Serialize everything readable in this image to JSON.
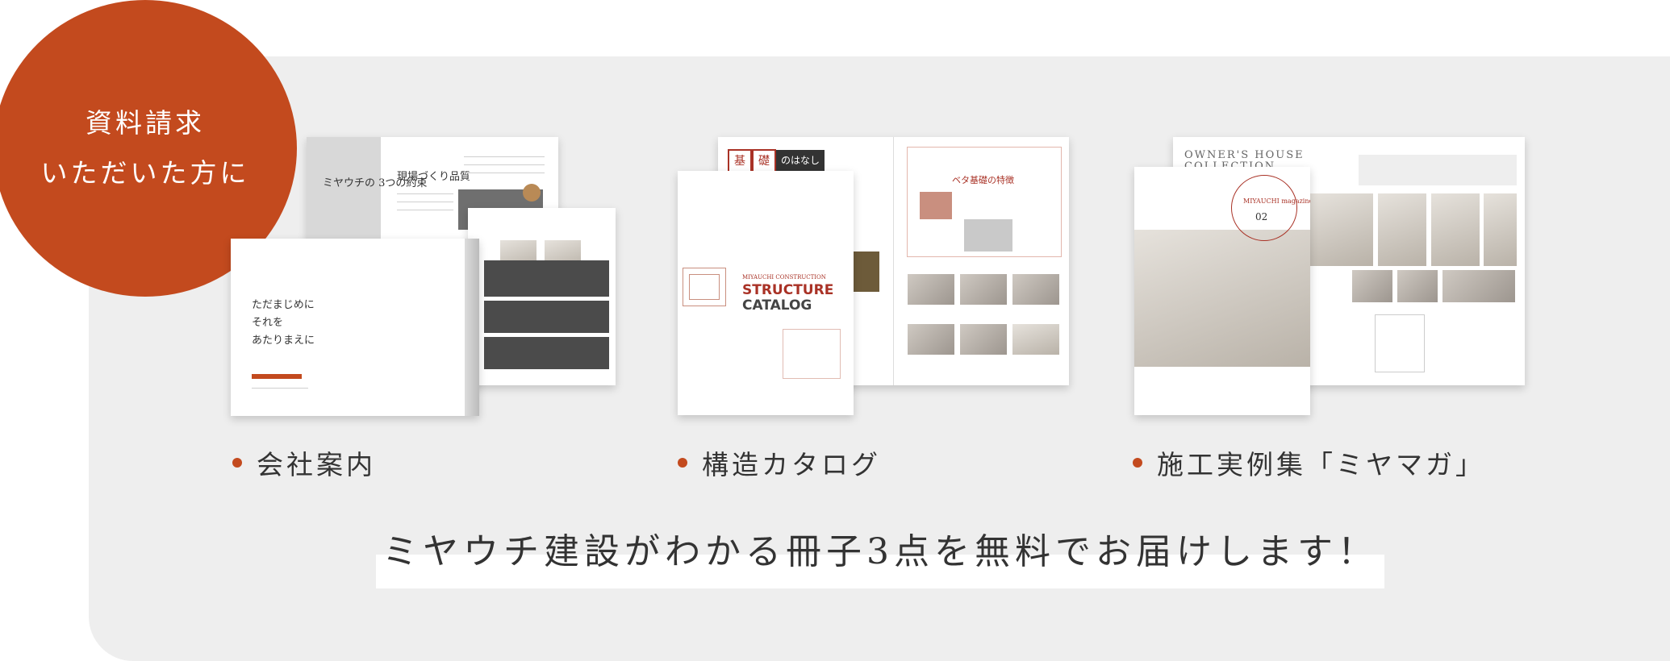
{
  "badge": {
    "line1": "資料請求",
    "line2": "いただいた方に"
  },
  "booklets": [
    {
      "label": "会社案内"
    },
    {
      "label": "構造カタログ"
    },
    {
      "label": "施工実例集「ミヤマガ」"
    }
  ],
  "company_guide": {
    "cover_lines": [
      "ただまじめに",
      "それを",
      "あたりまえに"
    ],
    "spread_title": "ミヤウチの 3つの約束",
    "spread_heading": "現場づくり品質"
  },
  "structure_catalog": {
    "brand": "MIYAUCHI CONSTRUCTION",
    "title_line1": "STRUCTURE",
    "title_line2": "CATALOG",
    "spread_tag1": "基",
    "spread_tag2": "礎",
    "spread_tag3": "のはなし",
    "spread_heading": "ベタ基礎の特徴"
  },
  "magazine": {
    "collection_title": "OWNER'S HOUSE COLLECTION",
    "brand_ring": "MIYAUCHI magazine",
    "issue": "02"
  },
  "cta": {
    "text": "ミヤウチ建設がわかる冊子3点を無料でお届けします！"
  },
  "colors": {
    "accent": "#c34a1e",
    "panel": "#eeeeee"
  }
}
